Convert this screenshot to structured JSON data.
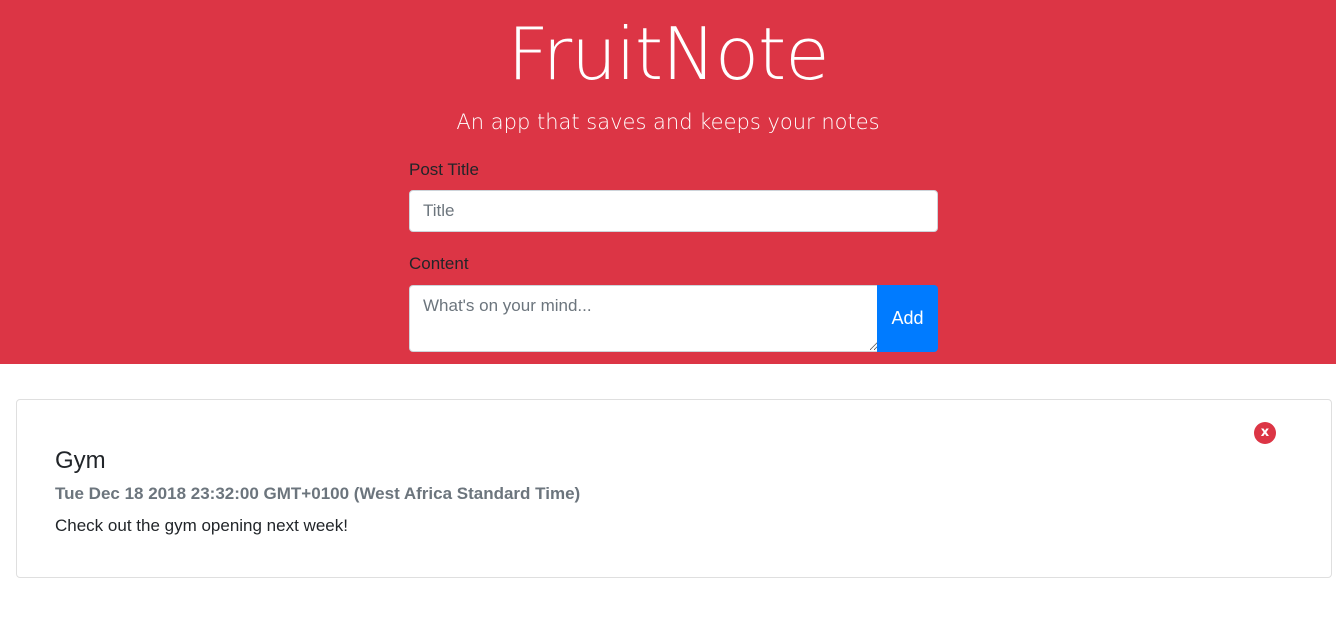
{
  "app": {
    "title": "FruitNote",
    "tagline": "An app that saves and keeps your notes"
  },
  "form": {
    "title_label": "Post Title",
    "title_placeholder": "Title",
    "title_value": "",
    "content_label": "Content",
    "content_placeholder": "What's on your mind...",
    "content_value": "",
    "add_label": "Add"
  },
  "notes": [
    {
      "title": "Gym",
      "date": "Tue Dec 18 2018 23:32:00 GMT+0100 (West Africa Standard Time)",
      "body": "Check out the gym opening next week!",
      "delete_label": "x"
    }
  ],
  "colors": {
    "hero_background": "#dc3545",
    "add_button": "#007bff",
    "delete_button": "#dc3545"
  }
}
